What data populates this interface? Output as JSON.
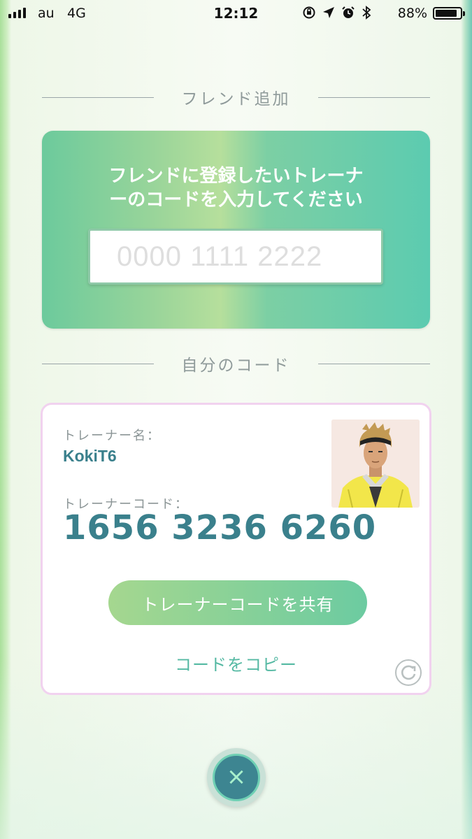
{
  "status_bar": {
    "carrier": "au",
    "network": "4G",
    "time": "12:12",
    "battery_percent": "88%",
    "battery_level": 0.88,
    "icons": [
      "rotation-lock-icon",
      "location-arrow-icon",
      "alarm-icon",
      "bluetooth-icon"
    ]
  },
  "friend_add": {
    "section_title": "フレンド追加",
    "message_line1": "フレンドに登録したいトレーナ",
    "message_line2": "ーのコードを入力してください",
    "code_placeholder": "0000 1111 2222",
    "code_value": ""
  },
  "my_code": {
    "section_title": "自分のコード",
    "trainer_name_label": "トレーナー名：",
    "trainer_name": "KokiT6",
    "trainer_code_label": "トレーナーコード：",
    "trainer_code": "1656 3236 6260",
    "share_button": "トレーナーコードを共有",
    "copy_link": "コードをコピー"
  },
  "close_button": {
    "symbol": "×"
  },
  "colors": {
    "accent_teal": "#3a808c",
    "card_gradient_start": "#6cca9c",
    "card_gradient_end": "#5ccbb0",
    "card_border_pink": "#f1d2ef"
  }
}
